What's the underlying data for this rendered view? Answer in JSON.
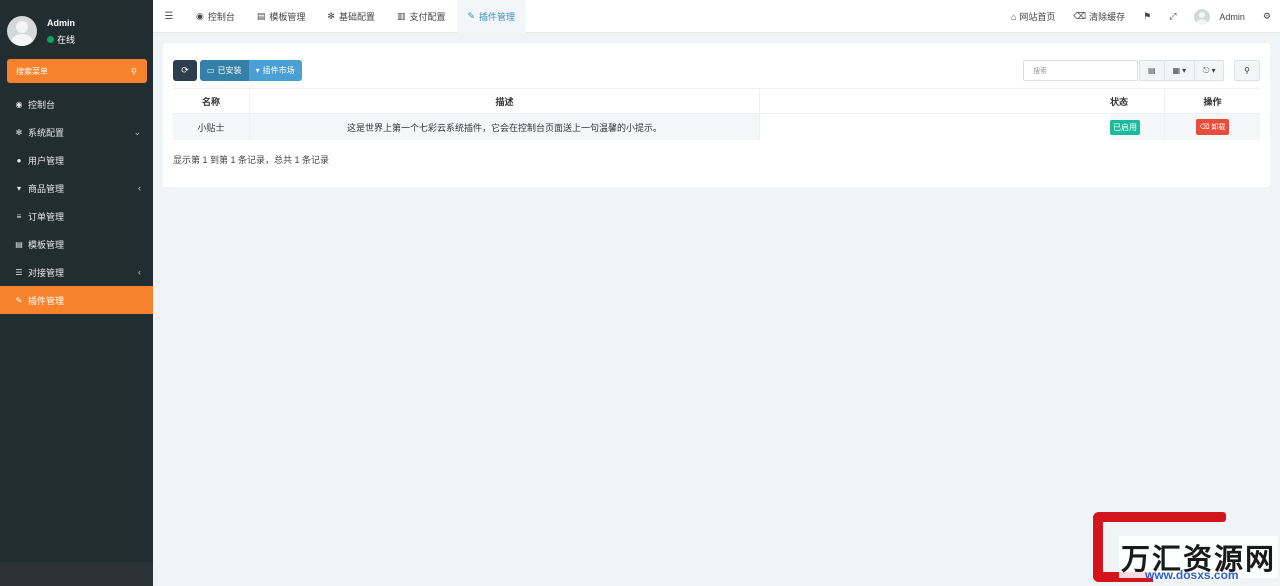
{
  "sidebar": {
    "user_name": "Admin",
    "user_status": "在线",
    "search_menu_label": "搜索菜单",
    "items": [
      {
        "label": "控制台",
        "icon": "dashboard-icon",
        "glyph": "◉",
        "arrow": ""
      },
      {
        "label": "系统配置",
        "icon": "gear-icon",
        "glyph": "✻",
        "arrow": "⌄"
      },
      {
        "label": "用户管理",
        "icon": "user-icon",
        "glyph": "●",
        "arrow": ""
      },
      {
        "label": "商品管理",
        "icon": "cart-icon",
        "glyph": "▾",
        "arrow": "‹"
      },
      {
        "label": "订单管理",
        "icon": "list-icon",
        "glyph": "≡",
        "arrow": ""
      },
      {
        "label": "模板管理",
        "icon": "template-icon",
        "glyph": "▤",
        "arrow": ""
      },
      {
        "label": "对接管理",
        "icon": "sliders-icon",
        "glyph": "☰",
        "arrow": "‹"
      },
      {
        "label": "插件管理",
        "icon": "plug-icon",
        "glyph": "✎",
        "arrow": ""
      }
    ]
  },
  "navbar": {
    "tabs": [
      {
        "label": "控制台",
        "glyph": "◉"
      },
      {
        "label": "模板管理",
        "glyph": "▤"
      },
      {
        "label": "基础配置",
        "glyph": "✻"
      },
      {
        "label": "支付配置",
        "glyph": "▥"
      },
      {
        "label": "插件管理",
        "glyph": "✎"
      }
    ],
    "site_home": "网站首页",
    "clear_cache": "清除缓存",
    "admin": "Admin"
  },
  "toolbar": {
    "installed": "已安装",
    "market": "插件市场",
    "search_placeholder": "搜索"
  },
  "table": {
    "headers": {
      "name": "名称",
      "desc": "描述",
      "status": "状态",
      "op": "操作"
    },
    "rows": [
      {
        "name": "小贴士",
        "desc": "这是世界上第一个七彩云系统插件，它会在控制台页面送上一句温馨的小提示。",
        "status": "已启用",
        "op": "卸载"
      }
    ]
  },
  "pager_info": "显示第 1 到第 1 条记录，总共 1 条记录",
  "watermark": {
    "text": "万汇资源网",
    "url": "www.dosxs.com"
  },
  "colors": {
    "accent": "#f7822c",
    "sidebar_bg": "#222d32",
    "primary": "#3c8dbc",
    "success": "#18bc9c",
    "danger": "#e74c3c"
  }
}
